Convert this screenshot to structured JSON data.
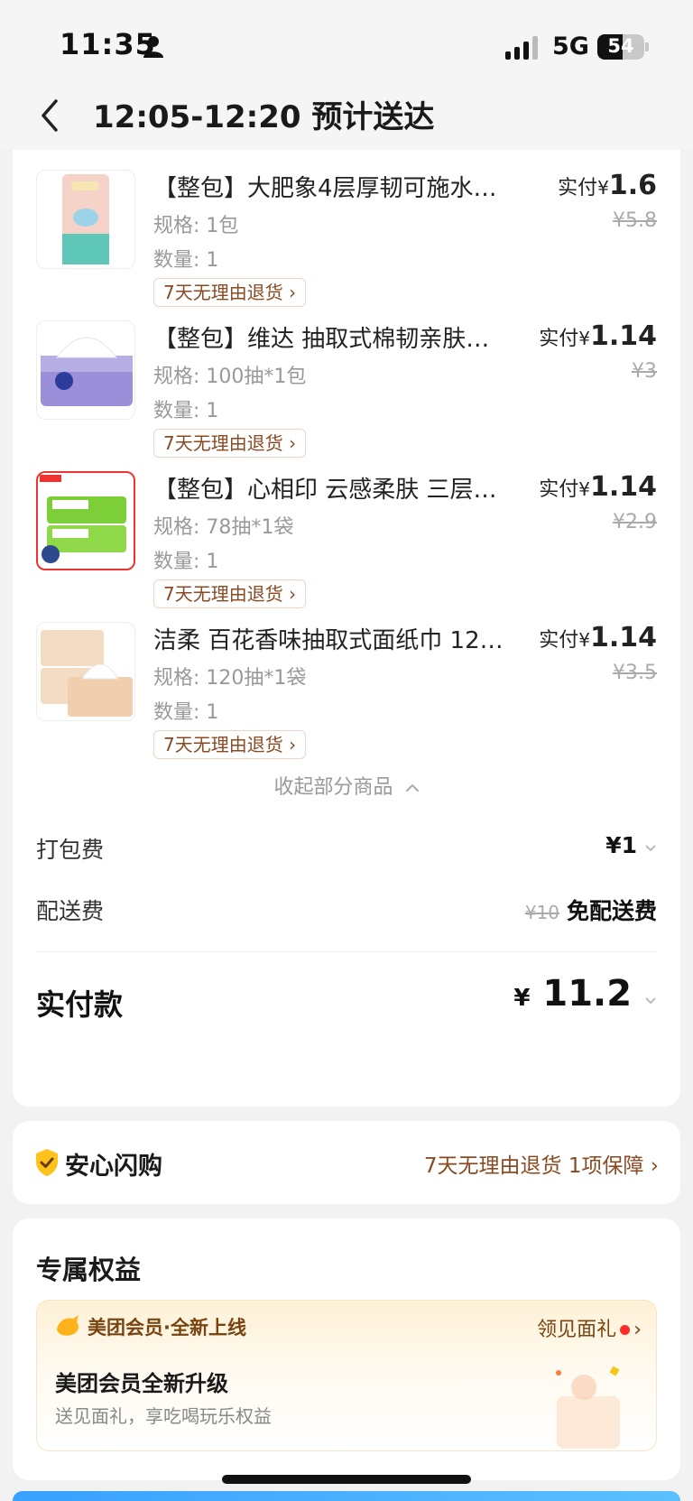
{
  "status_bar": {
    "time": "11:35",
    "network": "5G",
    "battery": "54",
    "battery_level": 0.54
  },
  "header": {
    "title": "12:05-12:20 预计送达"
  },
  "products": [
    {
      "title": "【整包】大肥象4层厚韧可施水…",
      "spec": "规格: 1包",
      "qty": "数量: 1",
      "return_tag": "7天无理由退货",
      "paid_label": "实付",
      "currency": "¥",
      "paid_amount": "1.6",
      "original_price": "¥5.8"
    },
    {
      "title": "【整包】维达 抽取式棉韧亲肤…",
      "spec": "规格: 100抽*1包",
      "qty": "数量: 1",
      "return_tag": "7天无理由退货",
      "paid_label": "实付",
      "currency": "¥",
      "paid_amount": "1.14",
      "original_price": "¥3"
    },
    {
      "title": "【整包】心相印 云感柔肤 三层…",
      "spec": "规格: 78抽*1袋",
      "qty": "数量: 1",
      "return_tag": "7天无理由退货",
      "paid_label": "实付",
      "currency": "¥",
      "paid_amount": "1.14",
      "original_price": "¥2.9"
    },
    {
      "title": "洁柔  百花香味抽取式面纸巾 12…",
      "spec": "规格: 120抽*1袋",
      "qty": "数量: 1",
      "return_tag": "7天无理由退货",
      "paid_label": "实付",
      "currency": "¥",
      "paid_amount": "1.14",
      "original_price": "¥3.5"
    }
  ],
  "collapse": {
    "label": "收起部分商品"
  },
  "fees": {
    "packing_label": "打包费",
    "packing_value": "¥1",
    "delivery_label": "配送费",
    "delivery_original": "¥10",
    "delivery_value": "免配送费"
  },
  "total": {
    "label": "实付款",
    "currency": "¥",
    "amount": "11.2"
  },
  "safe": {
    "title": "安心闪购",
    "detail": "7天无理由退货 1项保障"
  },
  "benefits": {
    "heading": "专属权益",
    "member_tag": "美团会员·全新上线",
    "gift_link": "领见面礼",
    "member_title": "美团会员全新升级",
    "member_desc": "送见面礼，享吃喝玩乐权益"
  },
  "colors": {
    "accent_brown": "#8a4a22",
    "member_brown": "#7a4410",
    "red_dot": "#ff2a2a"
  }
}
